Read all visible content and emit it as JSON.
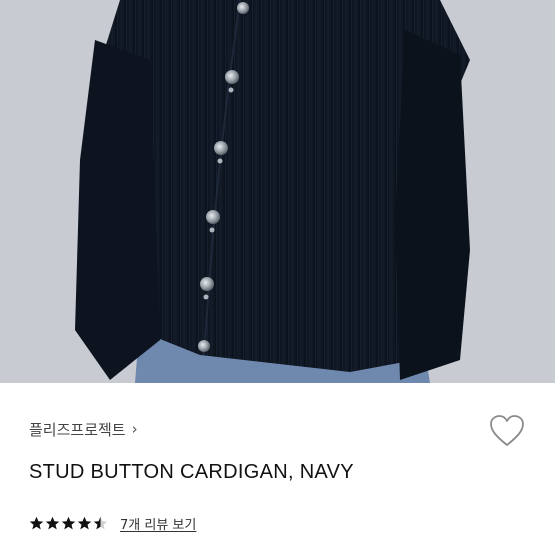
{
  "product": {
    "brand": "플리즈프로젝트",
    "brand_chevron": "›",
    "name": "STUD BUTTON CARDIGAN, NAVY",
    "rating": 4.5,
    "rating_max": 5,
    "review_link": "7개 리뷰 보기"
  },
  "icons": {
    "brand_chevron": "chevron-right-icon",
    "wishlist": "heart-outline-icon",
    "star": "star-icon"
  },
  "colors": {
    "cardigan_navy": "#0f1622",
    "background": "#c9cdd3",
    "stars": "#111111"
  }
}
